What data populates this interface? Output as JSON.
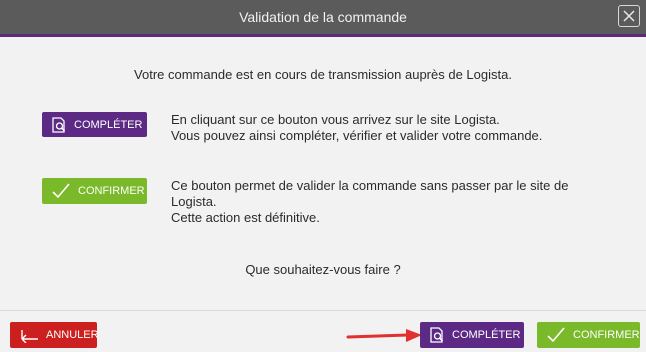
{
  "dialog": {
    "title": "Validation de la commande",
    "intro": "Votre commande est en cours de transmission auprès de Logista."
  },
  "completer": {
    "button_label": "COMPLÉTER",
    "description_line1": "En cliquant sur ce bouton vous arrivez sur le site Logista.",
    "description_line2": "Vous pouvez ainsi compléter, vérifier et valider votre commande."
  },
  "confirmer": {
    "button_label": "CONFIRMER",
    "description_line1": "Ce bouton permet de valider la commande sans passer par le site de",
    "description_line2": "Logista.",
    "description_line3": "Cette action est définitive."
  },
  "question": "Que souhaitez-vous faire ?",
  "footer": {
    "cancel_label": "ANNULER",
    "completer_label": "COMPLÉTER",
    "confirmer_label": "CONFIRMER"
  },
  "colors": {
    "titlebar": "#5b5b5b",
    "accent": "#5c2b7a",
    "purple_button": "#5c2a85",
    "green_button": "#7ab929",
    "red_button": "#cc2020",
    "arrow": "#e03030"
  },
  "icons": {
    "close": "close-icon",
    "completer": "search-document-icon",
    "confirmer": "checkmark-icon",
    "cancel": "back-arrow-icon"
  }
}
